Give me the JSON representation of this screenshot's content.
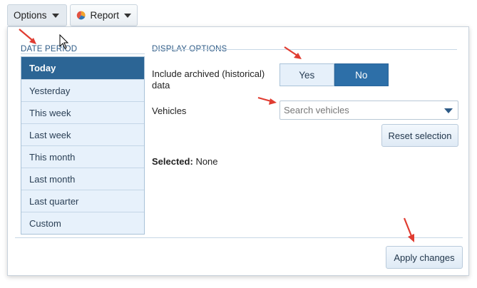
{
  "toolbar": {
    "options_label": "Options",
    "report_label": "Report"
  },
  "date_period": {
    "title": "DATE PERIOD",
    "items": [
      "Today",
      "Yesterday",
      "This week",
      "Last week",
      "This month",
      "Last month",
      "Last quarter",
      "Custom"
    ],
    "selected": "Today"
  },
  "display_options": {
    "title": "DISPLAY OPTIONS",
    "archived_label_line1": "Include archived (historical)",
    "archived_label_line2": "data",
    "yes_label": "Yes",
    "no_label": "No",
    "selected_toggle": "No",
    "vehicles_label": "Vehicles",
    "search_placeholder": "Search vehicles",
    "reset_label": "Reset selection",
    "selected_prefix": "Selected:",
    "selected_value": "None"
  },
  "footer": {
    "apply_label": "Apply changes"
  },
  "colors": {
    "accent": "#2c6595",
    "annotation_arrow": "#e03c31"
  }
}
